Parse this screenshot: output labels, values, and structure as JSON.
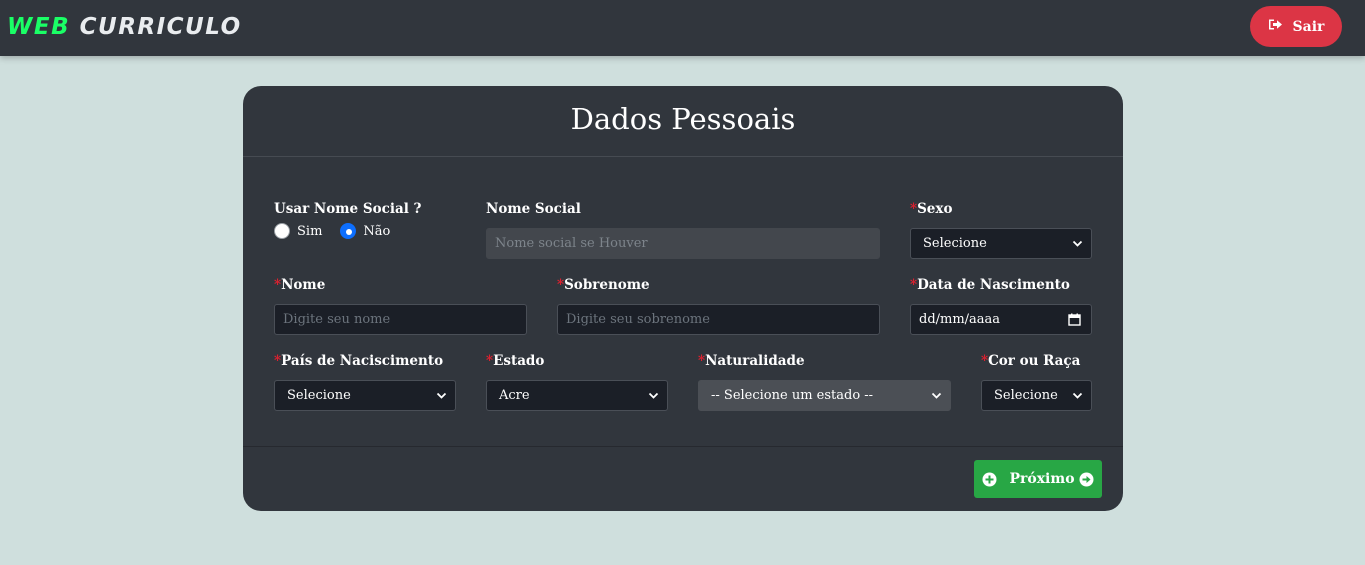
{
  "header": {
    "logo_part1": "WEB",
    "logo_part2": "CURRICULO",
    "logout_label": "Sair"
  },
  "form": {
    "title": "Dados Pessoais",
    "required_mark": "*",
    "use_social_name": {
      "label": "Usar Nome Social ?",
      "options": [
        {
          "label": "Sim",
          "checked": false
        },
        {
          "label": "Não",
          "checked": true
        }
      ]
    },
    "social_name": {
      "label": "Nome Social",
      "placeholder": "Nome social se Houver"
    },
    "sexo": {
      "label": "Sexo",
      "value": "Selecione"
    },
    "nome": {
      "label": "Nome",
      "placeholder": "Digite seu nome"
    },
    "sobrenome": {
      "label": "Sobrenome",
      "placeholder": "Digite seu sobrenome"
    },
    "data_nascimento": {
      "label": "Data de Nascimento",
      "value": "dd/mm/aaaa"
    },
    "pais": {
      "label": "País de Naciscimento",
      "value": "Selecione"
    },
    "estado": {
      "label": "Estado",
      "value": "Acre"
    },
    "naturalidade": {
      "label": "Naturalidade",
      "value": "-- Selecione um estado --"
    },
    "cor_raca": {
      "label": "Cor ou Raça",
      "value": "Selecione"
    },
    "next_label": "Próximo"
  },
  "colors": {
    "background": "#cfdfdd",
    "topbar": "#31363d",
    "logo_accent": "#1aff66",
    "logout_button": "#dc3545",
    "card": "#31363d",
    "required": "#e0202f",
    "radio_checked": "#0d6efd",
    "next_button": "#28a745"
  },
  "icons": {
    "logout": "sign-out-icon",
    "next_left": "plus-circle-icon",
    "next_right": "arrow-circle-right-icon",
    "select_chevron": "chevron-down-icon",
    "calendar": "calendar-icon"
  }
}
